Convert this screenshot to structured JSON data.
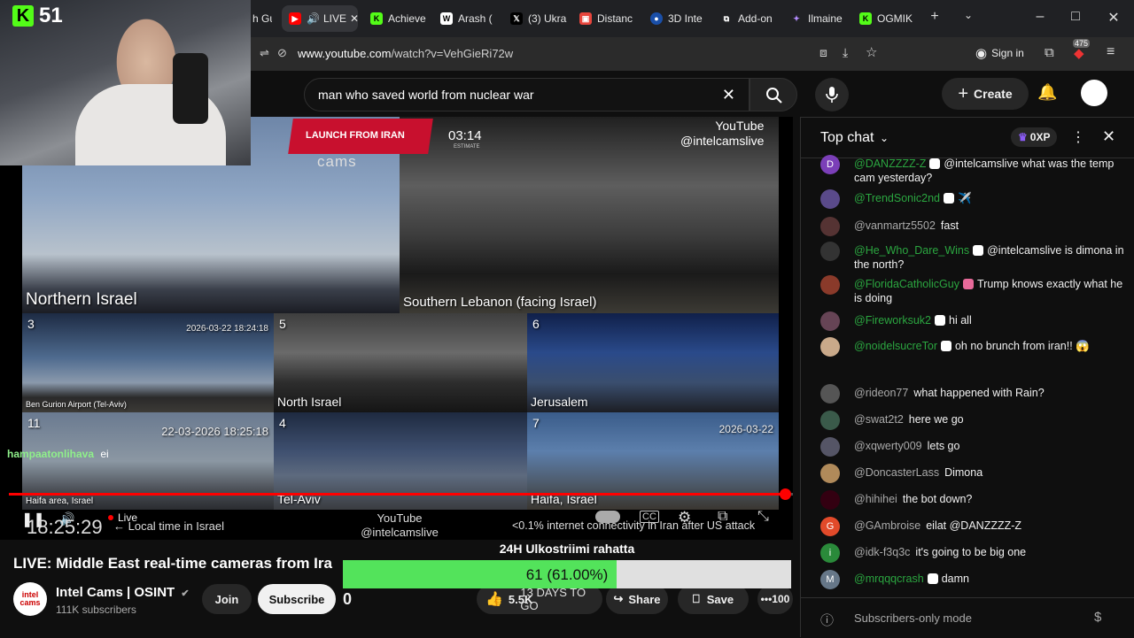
{
  "kick": {
    "count": "51"
  },
  "tabs": [
    {
      "label": "h Gu",
      "icon": ""
    },
    {
      "label": "LIVE",
      "icon": "youtube-icon"
    },
    {
      "label": "Achieve",
      "icon": "kick-icon"
    },
    {
      "label": "Arash (",
      "icon": "wikipedia-icon"
    },
    {
      "label": "(3) Ukra",
      "icon": "x-icon"
    },
    {
      "label": "Distanc",
      "icon": "maps-icon"
    },
    {
      "label": "3D Inte",
      "icon": "globe-icon"
    },
    {
      "label": "Add-on",
      "icon": "puzzle-icon"
    },
    {
      "label": "Ilmaine",
      "icon": "ilmaine-icon"
    },
    {
      "label": "OGMIK",
      "icon": "kick-icon"
    }
  ],
  "address": {
    "host": "www.youtube.com",
    "path": "/watch?v=VehGieRi72w",
    "sign_in": "Sign in",
    "ext_badge": "475"
  },
  "search": {
    "query": "man who saved world from nuclear war",
    "create": "Create"
  },
  "video": {
    "launch_banner": "LAUNCH FROM IRAN",
    "timer": "03:14",
    "timer_sub": "ESTIMATE",
    "watermark": "YouTube\n@intelcamslive",
    "cams_logo": "cams",
    "cams": [
      {
        "num": "",
        "label": "Northern Israel",
        "ts": ""
      },
      {
        "num": "",
        "label": "Southern Lebanon (facing Israel)",
        "ts": ""
      },
      {
        "num": "3",
        "label": "Ben Gurion Airport (Tel-Aviv)",
        "ts": "2026-03-22 18:24:18"
      },
      {
        "num": "5",
        "label": "North Israel",
        "ts": ""
      },
      {
        "num": "6",
        "label": "Jerusalem",
        "ts": ""
      },
      {
        "num": "11",
        "label": "Haifa area, Israel",
        "ts": "22-03-2026 18:25:18"
      },
      {
        "num": "4",
        "label": "Tel-Aviv",
        "ts": ""
      },
      {
        "num": "7",
        "label": "Haifa, Israel",
        "ts": "2026-03-22"
      }
    ],
    "chat_overlay_user": "hampaatonlihava",
    "chat_overlay_msg": "ei",
    "live_label": "Live",
    "local_time": "18:25:29",
    "local_time_label": "← Local time in Israel",
    "bottom_watermark": "YouTube\n@intelcamslive",
    "ticker": "<0.1% internet connectivity in Iran after US attack",
    "progress": 0.99
  },
  "below": {
    "title": "LIVE: Middle East real-time cameras from Ira",
    "channel": "Intel Cams | OSINT",
    "subscribers": "111K subscribers",
    "join": "Join",
    "subscribe": "Subscribe",
    "count_overlay": "0",
    "likes": "5.5K",
    "days_to_go": "13 DAYS TO GO",
    "share": "Share",
    "save": "Save",
    "more": "100"
  },
  "poll": {
    "title": "24H Ulkostriimi rahatta",
    "label": "61 (61.00%)",
    "fraction": 0.61
  },
  "chat": {
    "header": "Top chat",
    "xp": "0XP",
    "messages": [
      {
        "author": "@DANZZZZ-Z",
        "text": "@intelcamslive what was the temp cam yesterday?",
        "avatar": "D",
        "color": "#7b3fb8",
        "badge": true
      },
      {
        "author": "@TrendSonic2nd",
        "text": "✈️",
        "avatar": "",
        "color": "#5a4a8a",
        "badge": true
      },
      {
        "author": "@vanmartz5502",
        "text": "fast",
        "avatar": "",
        "color": "#553333",
        "badge": false,
        "plain": true
      },
      {
        "author": "@He_Who_Dare_Wins",
        "text": "@intelcamslive is dimona in the north?",
        "avatar": "",
        "color": "#333",
        "badge": true
      },
      {
        "author": "@FloridaCatholicGuy",
        "text": "Trump knows exactly what he is doing",
        "avatar": "",
        "color": "#8a3a2a",
        "badge": true,
        "pink": true
      },
      {
        "author": "@Fireworksuk2",
        "text": "hi all",
        "avatar": "",
        "color": "#664455",
        "badge": true
      },
      {
        "author": "@noidelsucreTor",
        "text": "oh no brunch from iran!! 😱",
        "avatar": "",
        "color": "#c9a98a",
        "badge": true
      },
      {
        "author": "@rideon77",
        "text": "what happened with Rain?",
        "avatar": "",
        "color": "#555",
        "badge": false,
        "plain": true
      },
      {
        "author": "@swat2t2",
        "text": "here we go",
        "avatar": "",
        "color": "#3a5a4a",
        "badge": false,
        "plain": true
      },
      {
        "author": "@xqwerty009",
        "text": "lets go",
        "avatar": "",
        "color": "#555566",
        "badge": false,
        "plain": true
      },
      {
        "author": "@DoncasterLass",
        "text": "Dimona",
        "avatar": "",
        "color": "#b08a5a",
        "badge": false,
        "plain": true
      },
      {
        "author": "@hihihei",
        "text": "the bot down?",
        "avatar": "",
        "color": "#330011",
        "badge": false,
        "plain": true
      },
      {
        "author": "@GAmbroise",
        "text": "eilat @DANZZZZ-Z",
        "avatar": "G",
        "color": "#e24a2a",
        "badge": false,
        "plain": true
      },
      {
        "author": "@idk-f3q3c",
        "text": "it's going to be big one",
        "avatar": "i",
        "color": "#2a8a3a",
        "badge": false,
        "plain": true
      },
      {
        "author": "@mrqqqcrash",
        "text": "damn",
        "avatar": "M",
        "color": "#667788",
        "badge": true
      }
    ],
    "footer": "Subscribers-only mode"
  }
}
